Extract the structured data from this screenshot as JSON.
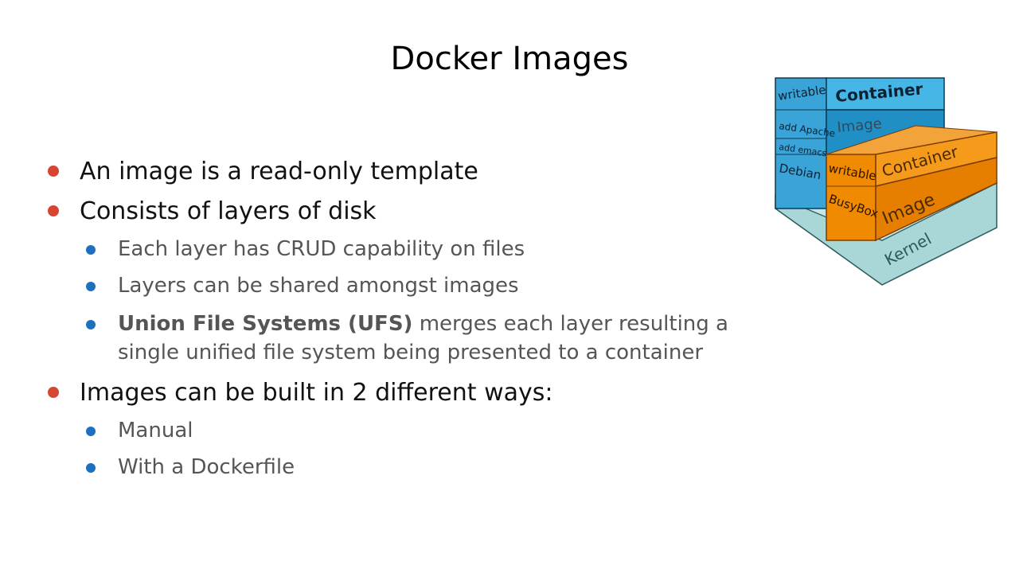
{
  "slide": {
    "title": "Docker Images",
    "bullets": [
      "An image is a read-only template",
      "Consists of layers of disk",
      "Images can be built in 2 different ways:"
    ],
    "layers_sub": [
      "Each layer has CRUD capability on files",
      "Layers can be shared amongst images"
    ],
    "ufs_bold": "Union File Systems (UFS)",
    "ufs_rest": " merges each layer resulting a single unified file system being presented to a container",
    "build_sub": [
      "Manual",
      "With a Dockerfile"
    ]
  },
  "diagram": {
    "left_stack": [
      "writable",
      "add Apache",
      "add emacs",
      "Debian"
    ],
    "left_container": "Container",
    "left_image": "Image",
    "right_stack": [
      "writable",
      "BusyBox"
    ],
    "right_container": "Container",
    "right_image": "Image",
    "kernel": "Kernel"
  },
  "colors": {
    "red_bullet": "#d64532",
    "blue_bullet": "#1f6fc0",
    "blue_layer": "#3aa3d8",
    "orange_layer": "#f08a00",
    "kernel_layer": "#a9d6d6"
  }
}
